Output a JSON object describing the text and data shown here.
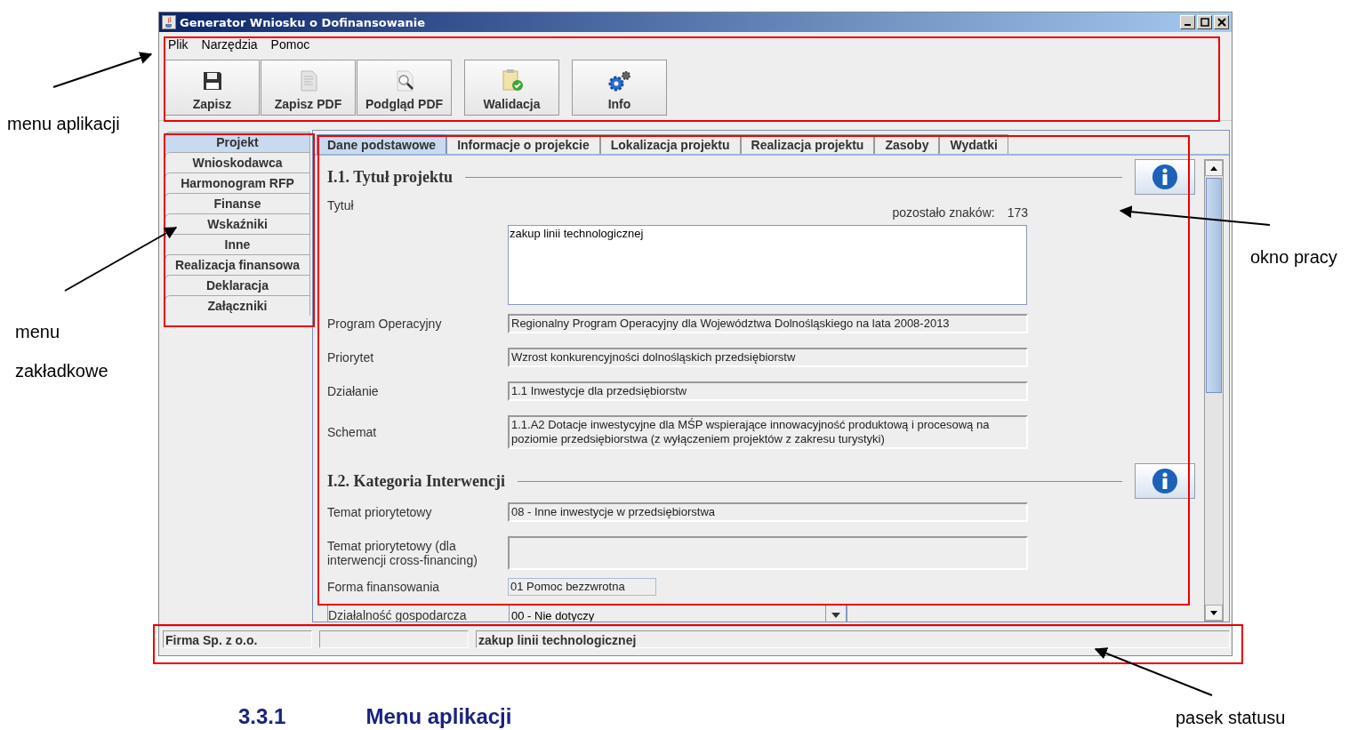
{
  "window": {
    "title": "Generator Wniosku o Dofinansowanie"
  },
  "menu": [
    "Plik",
    "Narzędzia",
    "Pomoc"
  ],
  "toolbar": [
    {
      "label": "Zapisz",
      "kind": "save"
    },
    {
      "label": "Zapisz PDF",
      "kind": "pdf"
    },
    {
      "label": "Podgląd PDF",
      "kind": "preview"
    },
    {
      "label": "Walidacja",
      "kind": "validate"
    },
    {
      "label": "Info",
      "kind": "info"
    }
  ],
  "side_tabs": [
    {
      "label": "Projekt",
      "selected": true
    },
    {
      "label": "Wnioskodawca",
      "selected": false
    },
    {
      "label": "Harmonogram RFP",
      "selected": false
    },
    {
      "label": "Finanse",
      "selected": false
    },
    {
      "label": "Wskaźniki",
      "selected": false
    },
    {
      "label": "Inne",
      "selected": false
    },
    {
      "label": "Realizacja finansowa",
      "selected": false
    },
    {
      "label": "Deklaracja",
      "selected": false
    },
    {
      "label": "Załączniki",
      "selected": false
    }
  ],
  "tabs": [
    {
      "label": "Dane podstawowe",
      "selected": true
    },
    {
      "label": "Informacje o projekcie",
      "selected": false
    },
    {
      "label": "Lokalizacja projektu",
      "selected": false
    },
    {
      "label": "Realizacja projektu",
      "selected": false
    },
    {
      "label": "Zasoby",
      "selected": false
    },
    {
      "label": "Wydatki",
      "selected": false
    }
  ],
  "sections": [
    {
      "title": "I.1. Tytuł projektu",
      "fields": [
        {
          "kind": "textarea",
          "label": "Tytuł",
          "counter_label": "pozostało znaków:",
          "counter": "173",
          "value": "zakup linii technologicznej"
        },
        {
          "kind": "readonly",
          "label": "Program Operacyjny",
          "value": "Regionalny Program Operacyjny dla Województwa Dolnośląskiego na lata 2008-2013"
        },
        {
          "kind": "readonly",
          "label": "Priorytet",
          "value": "Wzrost konkurencyjności dolnośląskich przedsiębiorstw"
        },
        {
          "kind": "readonly",
          "label": "Działanie",
          "value": "1.1 Inwestycje dla przedsiębiorstw"
        },
        {
          "kind": "readonly",
          "label": "Schemat",
          "value": "1.1.A2 Dotacje inwestycyjne dla MŚP wspierające innowacyjność produktową i procesową na poziomie przedsiębiorstwa (z wyłączeniem projektów z zakresu turystyki)"
        }
      ]
    },
    {
      "title": "I.2. Kategoria Interwencji",
      "fields": [
        {
          "kind": "readonly",
          "label": "Temat priorytetowy",
          "value": "08 - Inne inwestycje w przedsiębiorstwa"
        },
        {
          "kind": "tall",
          "label": "Temat priorytetowy (dla interwencji cross-financing)"
        },
        {
          "kind": "short",
          "label": "Forma finansowania",
          "value": "01 Pomoc bezzwrotna"
        },
        {
          "kind": "combo",
          "label": "Działalność gospodarcza",
          "value": "00 - Nie dotyczy"
        }
      ]
    }
  ],
  "status_bar": {
    "company": "Firma Sp. z o.o.",
    "project": "zakup linii technologicznej"
  },
  "annotations": [
    {
      "lines": [
        "menu aplikacji"
      ]
    },
    {
      "lines": [
        "menu",
        "zakładkowe"
      ]
    },
    {
      "lines": [
        "okno pracy"
      ]
    },
    {
      "lines": [
        "pasek statusu"
      ]
    }
  ],
  "heading": {
    "number": "3.3.1",
    "title": "Menu aplikacji"
  }
}
